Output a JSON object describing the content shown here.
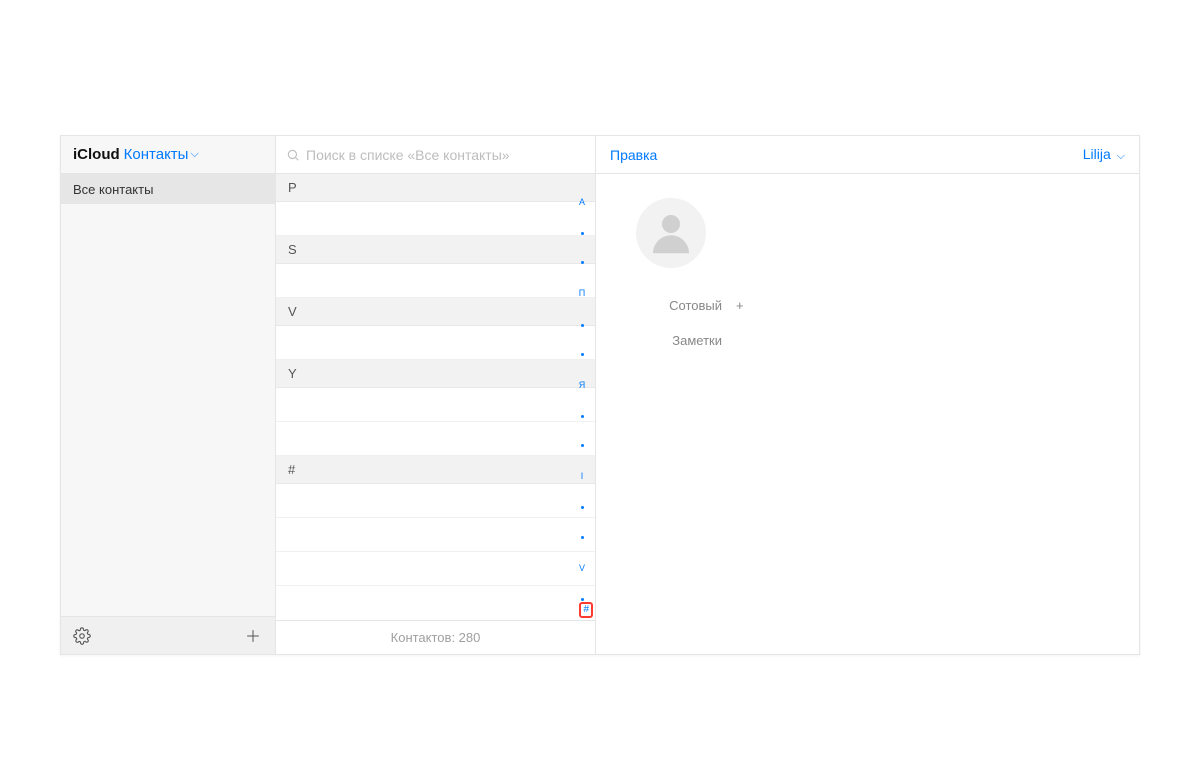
{
  "sidebar": {
    "icloud": "iCloud",
    "app_name": "Контакты",
    "groups": [
      "Все контакты"
    ]
  },
  "list": {
    "search_placeholder": "Поиск в списке «Все контакты»",
    "sections": [
      "P",
      "S",
      "V",
      "Y",
      "#"
    ],
    "footer": "Контактов: 280"
  },
  "index": {
    "letters_top": [
      "А",
      "П",
      "Я"
    ],
    "letters_bottom": [
      "I",
      "V"
    ],
    "hash": "#"
  },
  "detail": {
    "edit_label": "Правка",
    "contact_name": "Lilija",
    "fields": {
      "phone_label": "Сотовый",
      "phone_value": "+",
      "notes_label": "Заметки"
    }
  }
}
